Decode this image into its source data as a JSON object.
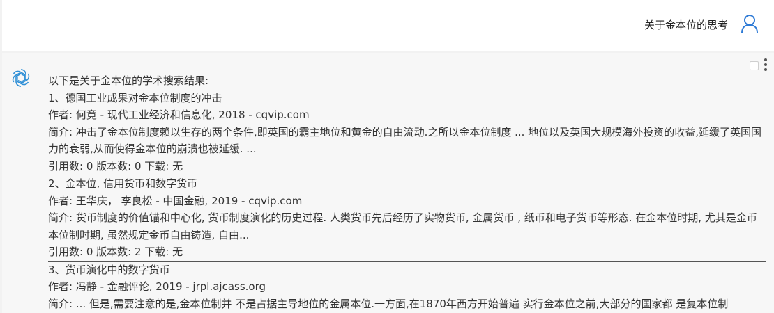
{
  "header": {
    "user_query": "关于金本位的思考",
    "avatar_icon": "user-icon"
  },
  "answer": {
    "bot_icon": "openai-logo-icon",
    "intro": "以下是关于金本位的学术搜索结果:",
    "results": [
      {
        "title": "1、德国工业成果对金本位制度的冲击",
        "author": "作者: 何竟 - 现代工业经济和信息化, 2018 - cqvip.com",
        "summary": "简介: 冲击了金本位制度赖以生存的两个条件,即英国的霸主地位和黄金的自由流动.之所以金本位制度 ... 地位以及英国大规模海外投资的收益,延缓了英国国力的衰弱,从而使得金本位的崩溃也被延缓. ...",
        "stats": "引用数: 0 版本数: 0 下载: 无"
      },
      {
        "title": "2、金本位, 信用货币和数字货币",
        "author": "作者: 王华庆， 李良松 - 中国金融, 2019 - cqvip.com",
        "summary": "简介: 货币制度的价值锚和中心化, 货币制度演化的历史过程. 人类货币先后经历了实物货币, 金属货币 , 纸币和电子货币等形态. 在金本位时期, 尤其是金币本位制时期, 虽然规定金币自由铸造, 自由...",
        "stats": "引用数: 0 版本数: 2 下载: 无"
      },
      {
        "title": "3、货币演化中的数字货币",
        "author": "作者: 冯静 - 金融评论, 2019 - jrpl.ajcass.org",
        "summary": "简介: ... 但是,需要注意的是,金本位制并 不是占据主导地位的金属本位.一方面,在1870年西方开始普遍 实行金本位之前,大部分的国家都 是复本位制",
        "stats": ""
      }
    ]
  }
}
